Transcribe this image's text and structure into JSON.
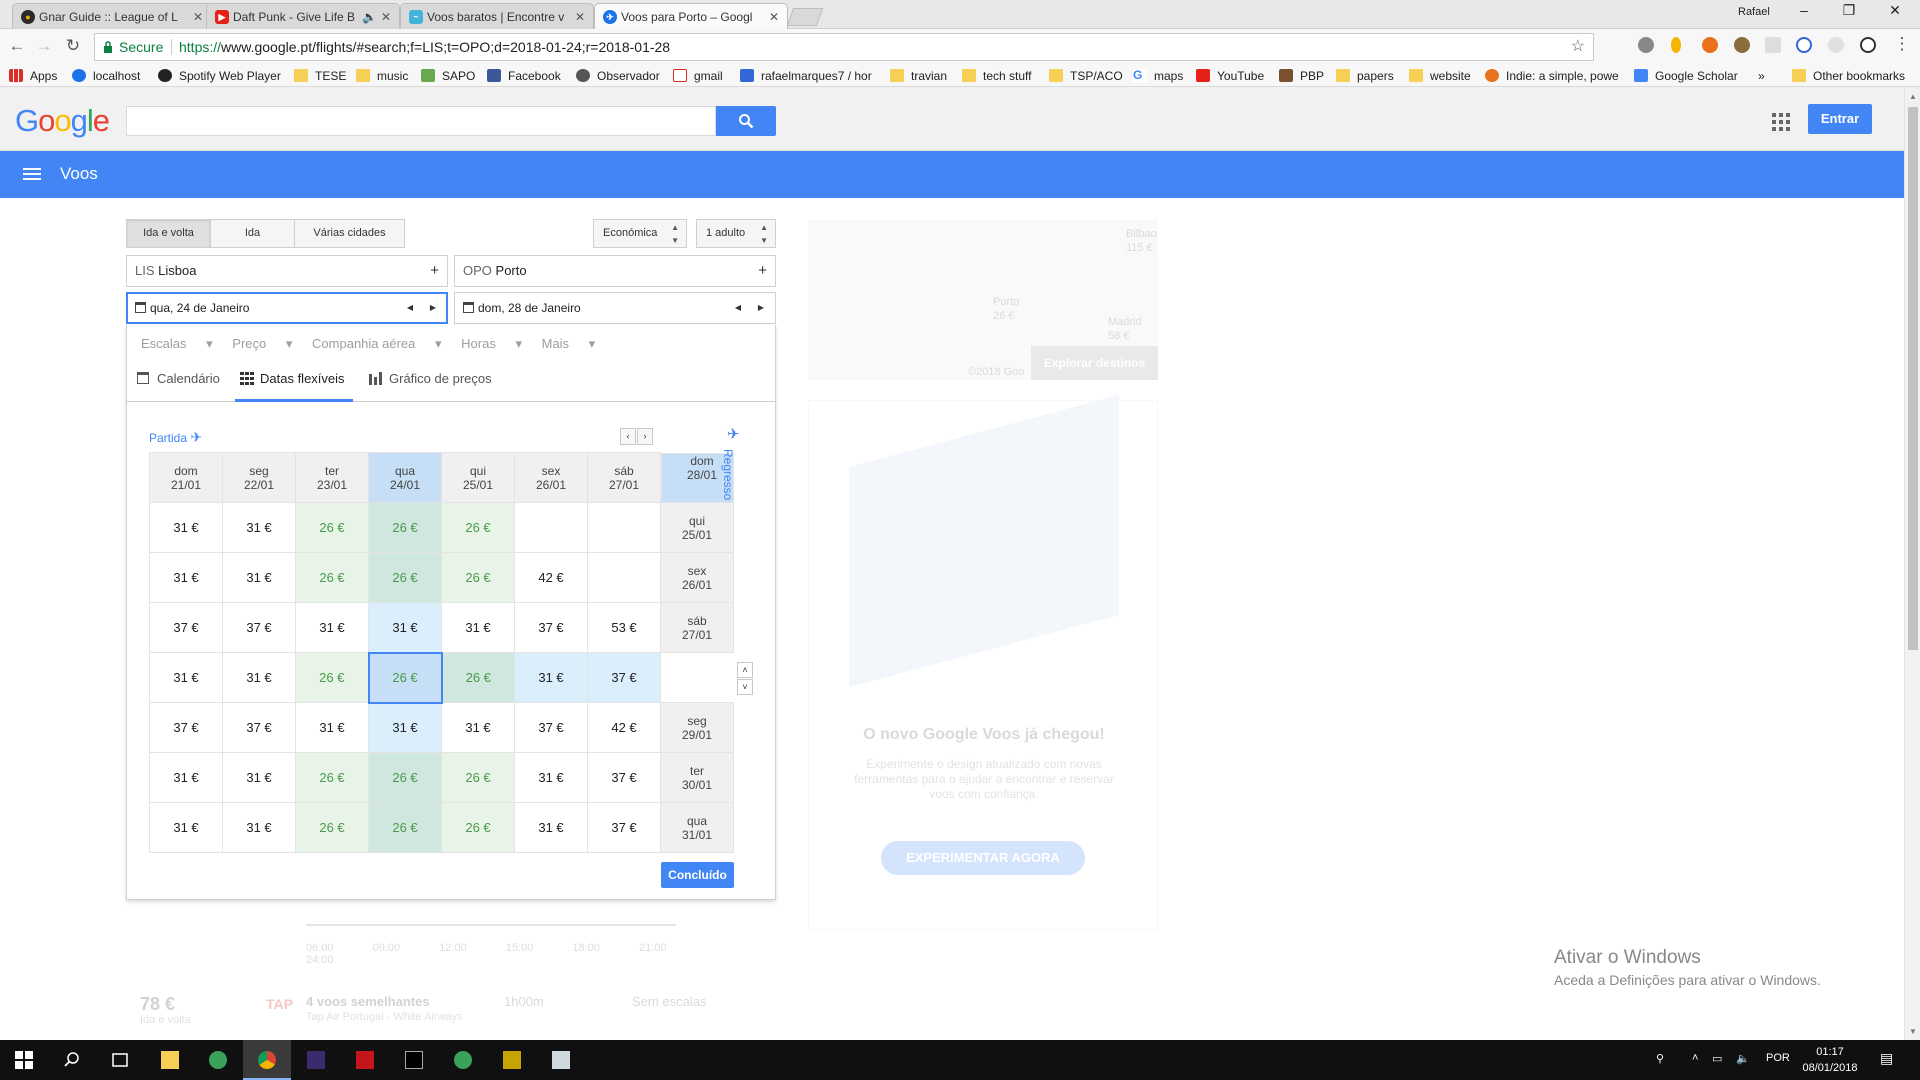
{
  "browser": {
    "tabs": [
      {
        "title": "Gnar Guide :: League of L",
        "icon_color": "#c8a200",
        "icon": "league-icon"
      },
      {
        "title": "Daft Punk - Give Life B",
        "icon_color": "#e62117",
        "icon": "youtube-icon"
      },
      {
        "title": "Voos baratos | Encontre v",
        "icon_color": "#43b3d9",
        "icon": "skyscanner-icon"
      },
      {
        "title": "Voos para Porto – Googl",
        "icon_color": "#1a73e8",
        "icon": "google-flights-icon"
      }
    ],
    "user": "Rafael",
    "secure_label": "Secure",
    "url_scheme": "https://",
    "url_rest": "www.google.pt/flights/#search;f=LIS;t=OPO;d=2018-01-24;r=2018-01-28",
    "bookmarks": [
      "Apps",
      "localhost",
      "Spotify Web Player",
      "TESE",
      "music",
      "SAPO",
      "Facebook",
      "Observador",
      "gmail",
      "rafaelmarques7 / hor",
      "travian",
      "tech stuff",
      "TSP/ACO",
      "maps",
      "YouTube",
      "PBP",
      "papers",
      "website",
      "Indie: a simple, powe",
      "Google Scholar",
      "»",
      "Other bookmarks"
    ]
  },
  "google": {
    "logo": "Google",
    "signin": "Entrar",
    "app_title": "Voos"
  },
  "form": {
    "trip_types": [
      "Ida e volta",
      "Ida",
      "Várias cidades"
    ],
    "cabin": "Económica",
    "passengers": "1 adulto",
    "origin_code": "LIS",
    "origin_city": "Lisboa",
    "dest_code": "OPO",
    "dest_city": "Porto",
    "depart_date": "qua, 24 de Janeiro",
    "return_date": "dom, 28 de Janeiro"
  },
  "filters": [
    "Escalas",
    "Preço",
    "Companhia aérea",
    "Horas",
    "Mais"
  ],
  "views": [
    "Calendário",
    "Datas flexíveis",
    "Gráfico de preços"
  ],
  "grid": {
    "partida_label": "Partida",
    "regresso_label": "Regresso",
    "depart_days": [
      [
        "dom",
        "21/01"
      ],
      [
        "seg",
        "22/01"
      ],
      [
        "ter",
        "23/01"
      ],
      [
        "qua",
        "24/01"
      ],
      [
        "qui",
        "25/01"
      ],
      [
        "sex",
        "26/01"
      ],
      [
        "sáb",
        "27/01"
      ]
    ],
    "return_days": [
      [
        "qui",
        "25/01"
      ],
      [
        "sex",
        "26/01"
      ],
      [
        "sáb",
        "27/01"
      ],
      [
        "dom",
        "28/01"
      ],
      [
        "seg",
        "29/01"
      ],
      [
        "ter",
        "30/01"
      ],
      [
        "qua",
        "31/01"
      ]
    ],
    "prices": [
      [
        "31 €",
        "31 €",
        "26 €",
        "26 €",
        "26 €",
        "",
        ""
      ],
      [
        "31 €",
        "31 €",
        "26 €",
        "26 €",
        "26 €",
        "42 €",
        ""
      ],
      [
        "37 €",
        "37 €",
        "31 €",
        "31 €",
        "31 €",
        "37 €",
        "53 €"
      ],
      [
        "31 €",
        "31 €",
        "26 €",
        "26 €",
        "26 €",
        "31 €",
        "37 €"
      ],
      [
        "37 €",
        "37 €",
        "31 €",
        "31 €",
        "31 €",
        "37 €",
        "42 €"
      ],
      [
        "31 €",
        "31 €",
        "26 €",
        "26 €",
        "26 €",
        "31 €",
        "37 €"
      ],
      [
        "31 €",
        "31 €",
        "26 €",
        "26 €",
        "26 €",
        "31 €",
        "37 €"
      ]
    ],
    "done_label": "Concluído"
  },
  "background": {
    "map_labels": [
      "Bilbao",
      "115 €",
      "Porto",
      "26 €",
      "Madrid",
      "58 €",
      "©2018 Goo"
    ],
    "map_button": "Explorar destinos",
    "promo_title": "O novo Google Voos já chegou!",
    "promo_desc": "Experimente o design atualizado com novas ferramentas para o ajudar a encontrar e reservar voos com confiança.",
    "promo_button": "EXPERIMENTAR AGORA",
    "result_price": "78 €",
    "result_sub": "Ida e volta",
    "result_title": "4 voos semelhantes",
    "result_airline": "Tap Air Portugal · White Airways",
    "result_duration": "1h00m",
    "result_stops": "Sem escalas",
    "time_ticks": [
      "06:00",
      "09:00",
      "12:00",
      "15:00",
      "18:00",
      "21:00",
      "24:00"
    ]
  },
  "watermark": {
    "line1": "Ativar o Windows",
    "line2": "Aceda a Definições para ativar o Windows."
  },
  "taskbar": {
    "lang": "POR",
    "time": "01:17",
    "date": "08/01/2018"
  },
  "colors": {
    "google_blue": "#4285f4",
    "cheap_green": "#4a9a4a",
    "secure_green": "#0b8043"
  }
}
